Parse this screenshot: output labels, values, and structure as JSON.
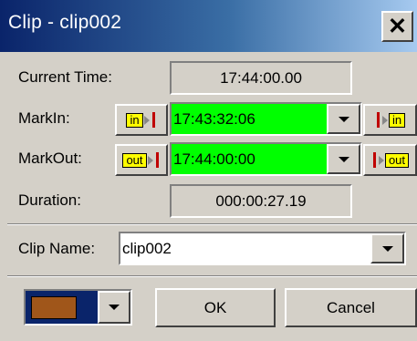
{
  "title": "Clip - clip002",
  "close_icon": "close-icon",
  "current_time": {
    "label": "Current Time:",
    "value": "17:44:00.00"
  },
  "mark_in": {
    "label": "MarkIn:",
    "left_button_tag": "in",
    "value": "17:43:32:06",
    "right_button_tag": "in"
  },
  "mark_out": {
    "label": "MarkOut:",
    "left_button_tag": "out",
    "value": "17:44:00:00",
    "right_button_tag": "out"
  },
  "duration": {
    "label": "Duration:",
    "value": "000:00:27.19"
  },
  "clip_name": {
    "label": "Clip Name:",
    "value": "clip002"
  },
  "color_selector": {
    "value": "1",
    "color": "#a0561a"
  },
  "buttons": {
    "ok": "OK",
    "cancel": "Cancel"
  },
  "colors": {
    "titlebar_start": "#0a246a",
    "timecode_bg": "#00ff00",
    "mark_tag": "#ffff00",
    "mark_bar": "#c00000"
  }
}
